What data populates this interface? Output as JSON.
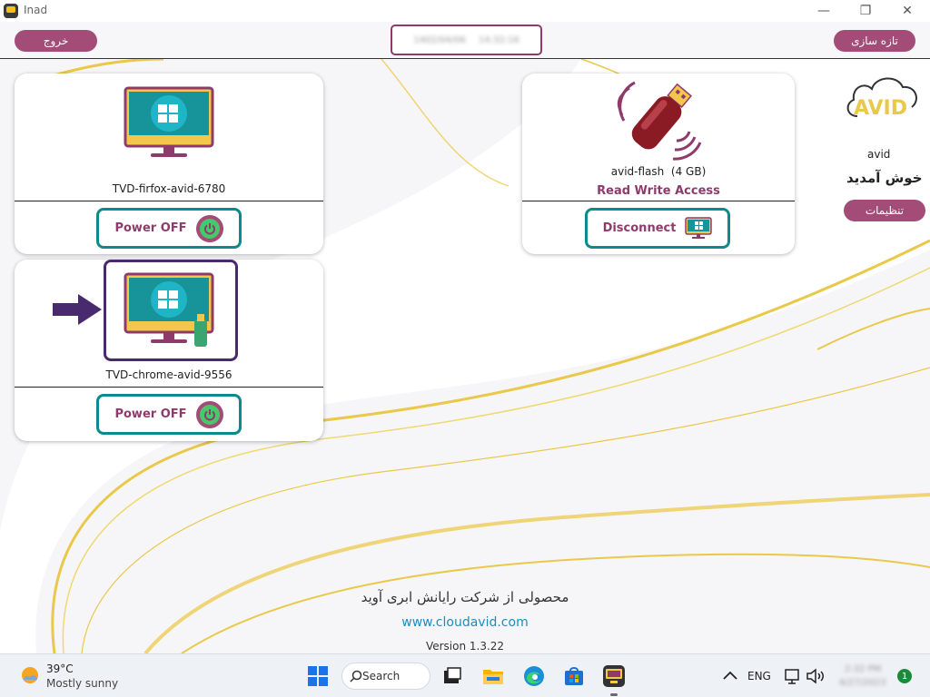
{
  "window": {
    "title": "Inad",
    "minimize_symbol": "—",
    "maximize_symbol": "❐",
    "close_symbol": "✕"
  },
  "header": {
    "exit_label": "خروج",
    "refresh_label": "تازه سازی",
    "date": "1402/04/06",
    "time": "14:32:16"
  },
  "vms": [
    {
      "name": "TVD-firfox-avid-6780",
      "action_label": "Power OFF",
      "selected": false,
      "has_usb": false
    },
    {
      "name": "TVD-chrome-avid-9556",
      "action_label": "Power OFF",
      "selected": true,
      "has_usb": true
    }
  ],
  "usb_device": {
    "name": "avid-flash",
    "size": "(4 GB)",
    "access": "Read Write Access",
    "action_label": "Disconnect"
  },
  "sidebar": {
    "logo_text": "AVID",
    "username": "avid",
    "welcome": "خوش آمدید",
    "settings_label": "تنظیمات"
  },
  "footer": {
    "company": "محصولی از شرکت رایانش ابری آوید",
    "website": "www.cloudavid.com",
    "version": "Version 1.3.22"
  },
  "taskbar": {
    "weather_temp": "39°C",
    "weather_condition": "Mostly sunny",
    "search_label": "Search",
    "language": "ENG",
    "clock_time": "2:32 PM",
    "clock_date": "6/27/2023",
    "notification_count": "1"
  },
  "colors": {
    "accent": "#a34c78",
    "teal": "#0e8a8c",
    "gold": "#e9c84a",
    "selection": "#4a2a6e"
  },
  "icons": {
    "monitor": "windows-monitor-icon",
    "usb": "usb-flash-icon",
    "power": "power-icon",
    "logo": "avid-cloud-logo"
  }
}
